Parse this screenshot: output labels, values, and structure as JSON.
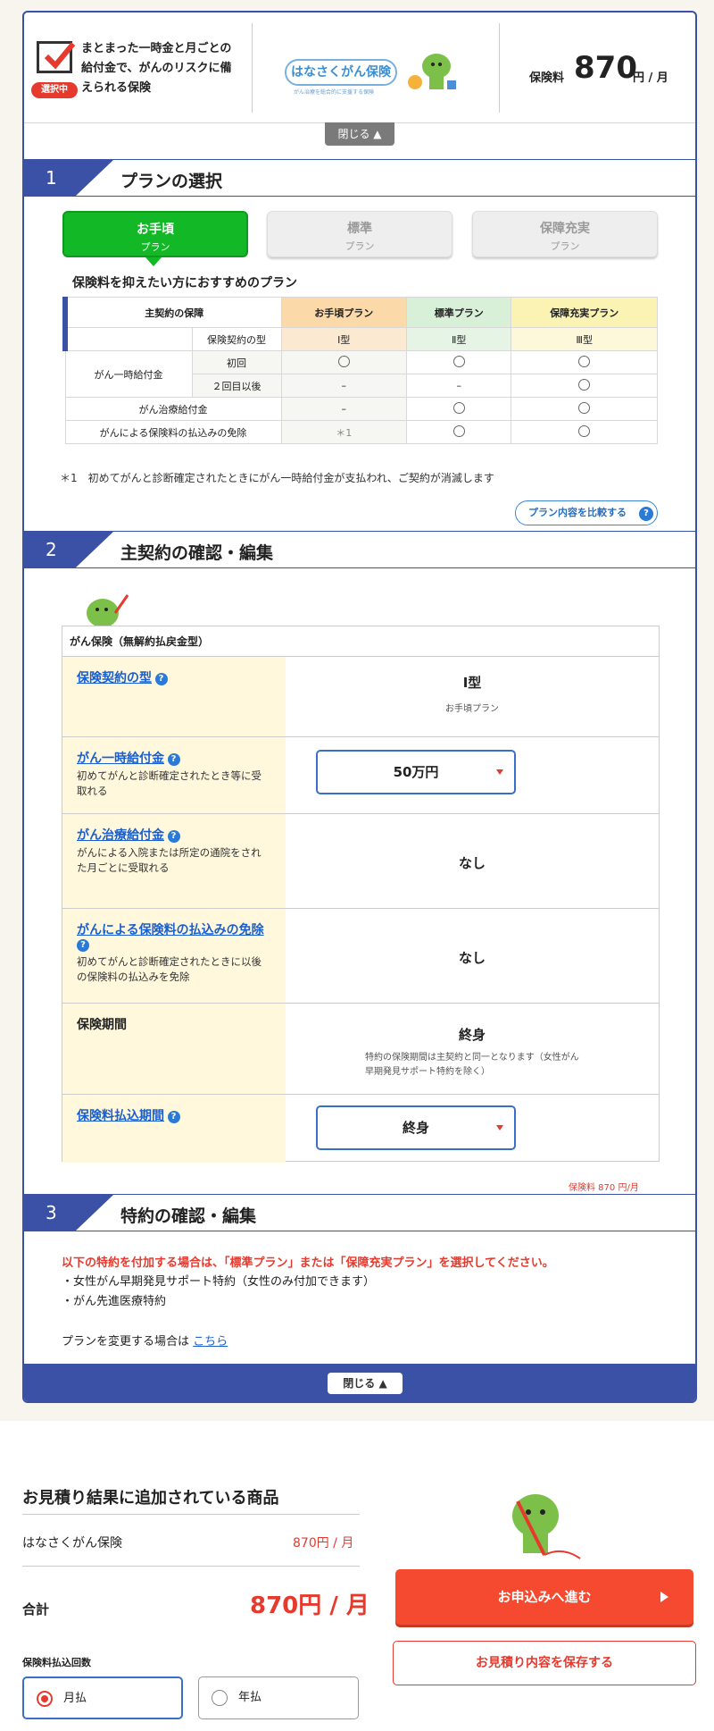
{
  "summary": {
    "selected_badge": "選択中",
    "text": "まとまった一時金と月ごとの給付金で、がんのリスクに備えられる保険",
    "logo_text": "はなさくがん保険",
    "logo_sub": "がん治療を総合的に支援する保険",
    "price_label": "保険料",
    "price": "870",
    "price_unit": "円 / 月",
    "close_label": "閉じる ▲"
  },
  "section1": {
    "num": "1",
    "title": "プランの選択",
    "plans": [
      {
        "name": "お手頃",
        "sub": "プラン"
      },
      {
        "name": "標準",
        "sub": "プラン"
      },
      {
        "name": "保障充実",
        "sub": "プラン"
      }
    ],
    "desc": "保険料を抑えたい方におすすめのプラン",
    "table": {
      "head_main": "主契約の保障",
      "head_type": "保険契約の型",
      "cols": [
        "お手頃プラン",
        "標準プラン",
        "保障充実プラン"
      ],
      "types": [
        "Ⅰ型",
        "Ⅱ型",
        "Ⅲ型"
      ],
      "row_lump": "がん一時給付金",
      "row_first": "初回",
      "row_second": "２回目以後",
      "row_treat": "がん治療給付金",
      "row_waiver": "がんによる保険料の払込みの免除",
      "dash": "–",
      "star": "＊1"
    },
    "note": "＊1　初めてがんと診断確定されたときにがん一時給付金が支払われ、ご契約が消滅します",
    "compare_label": "プラン内容を比較する"
  },
  "section2": {
    "num": "2",
    "title": "主契約の確認・編集",
    "contract_title": "がん保険（無解約払戻金型）",
    "rows": [
      {
        "label": "保険契約の型",
        "desc": "",
        "value": "Ⅰ型",
        "sub": "お手頃プラン"
      },
      {
        "label": "がん一時給付金",
        "desc": "初めてがんと診断確定されたとき等に受取れる",
        "value": "50万円"
      },
      {
        "label": "がん治療給付金",
        "desc": "がんによる入院または所定の通院をされた月ごとに受取れる",
        "value": "なし"
      },
      {
        "label": "がんによる保険料の払込みの免除",
        "desc": "初めてがんと診断確定されたときに以後の保険料の払込みを免除",
        "value": "なし"
      },
      {
        "label": "保険期間",
        "desc": "",
        "value": "終身",
        "sub": "特約の保険期間は主契約と同一となります（女性がん早期発見サポート特約を除く）"
      },
      {
        "label": "保険料払込期間",
        "desc": "",
        "value": "終身"
      }
    ],
    "premium_note": "保険料 870 円/月"
  },
  "section3": {
    "num": "3",
    "title": "特約の確認・編集",
    "warning": "以下の特約を付加する場合は、「標準プラン」または「保障充実プラン」を選択してください。",
    "items": [
      "・女性がん早期発見サポート特約（女性のみ付加できます）",
      "・がん先進医療特約"
    ],
    "change_text": "プランを変更する場合は",
    "change_link": "こちら",
    "close_label": "閉じる ▲"
  },
  "result": {
    "title": "お見積り結果に追加されている商品",
    "item_name": "はなさくがん保険",
    "item_price": "870円 / 月",
    "total_label": "合計",
    "total_value": "870円 / 月",
    "freq_label": "保険料払込回数",
    "monthly": "月払",
    "yearly": "年払",
    "apply_label": "お申込みへ進む",
    "save_label": "お見積り内容を保存する"
  },
  "colors": {
    "brand_blue": "#3a51a6",
    "green": "#12b826",
    "red": "#e63a2e"
  }
}
